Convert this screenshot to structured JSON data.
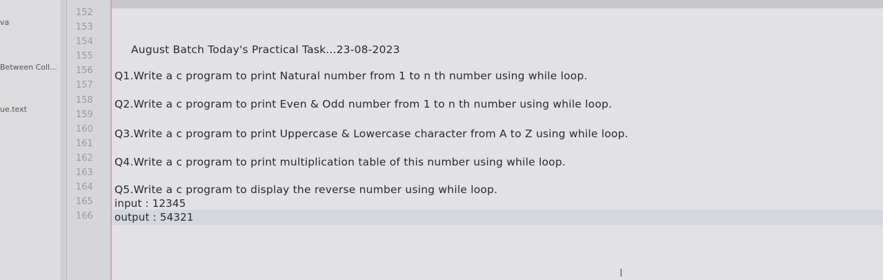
{
  "sidebar": {
    "items": [
      "va",
      "Between Coll...",
      "ue.text"
    ]
  },
  "gutter": {
    "line_numbers": [
      "152",
      "153",
      "154",
      "155",
      "156",
      "157",
      "158",
      "159",
      "160",
      "161",
      "162",
      "163",
      "164",
      "165",
      "166"
    ]
  },
  "editor": {
    "title": "August  Batch Today's Practical Task...23-08-2023",
    "q1": "Q1.Write a c program to print Natural number from 1 to n th number using while loop.",
    "q2": "Q2.Write a c program to print Even & Odd number from 1 to n th number using while loop.",
    "q3": "Q3.Write a c program to print Uppercase & Lowercase  character from A to Z using while loop.",
    "q4": "Q4.Write a c program to print multiplication table of this number using while loop.",
    "q5": "Q5.Write a c program to display the reverse number using while loop.",
    "input_line": "input : 12345",
    "output_line": "output : 54321",
    "cursor_glyph": "I"
  }
}
